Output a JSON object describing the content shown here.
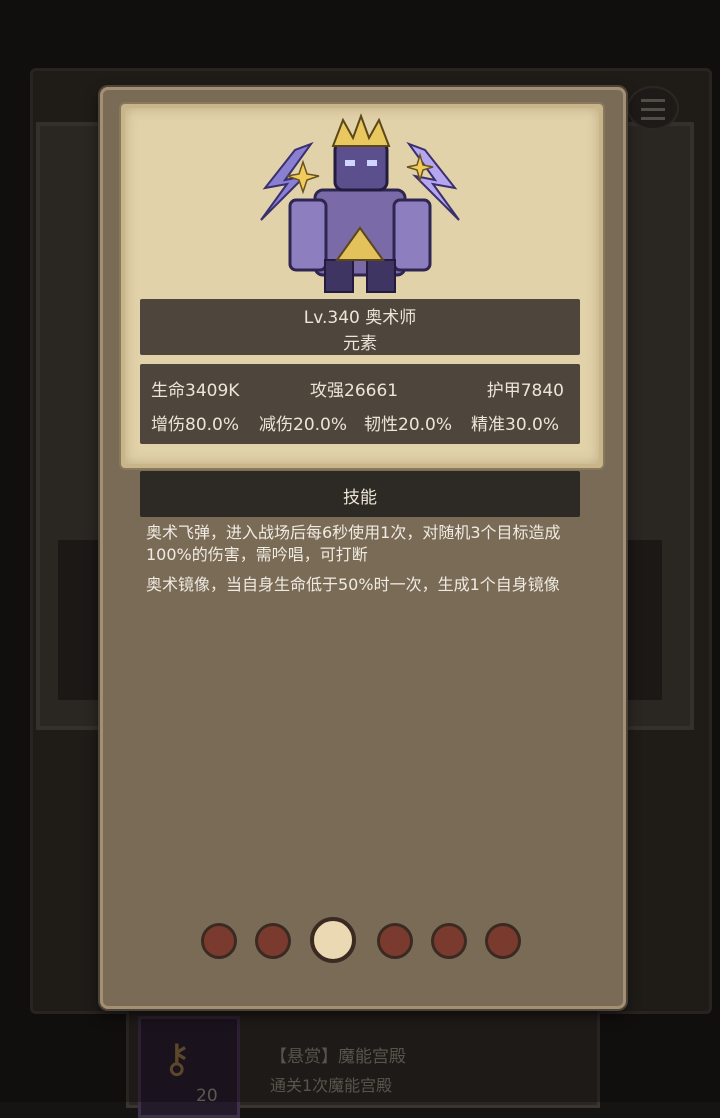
{
  "monster": {
    "level_name": "Lv.340 奥术师",
    "element": "元素",
    "stats_row1": [
      "生命3409K",
      "攻强26661",
      "护甲7840"
    ],
    "stats_row2": [
      "增伤80.0%",
      "减伤20.0%",
      "韧性20.0%",
      "精准30.0%"
    ]
  },
  "skills": {
    "header": "技能",
    "items": [
      "奥术飞弹，进入战场后每6秒使用1次，对随机3个目标造成100%的伤害，需吟唱，可打断",
      "奥术镜像，当自身生命低于50%时一次，生成1个自身镜像"
    ]
  },
  "pagination": {
    "total": 6,
    "active_index": 2
  },
  "background_item": {
    "title": "【悬赏】魔能宫殿",
    "desc": "通关1次魔能宫殿",
    "qty": "20"
  },
  "colors": {
    "card": "#7a6b57",
    "parchment": "#e2d2a9",
    "plate": "#4e463d",
    "dot_inactive": "#7a3a2e",
    "dot_active": "#ead9b2"
  }
}
